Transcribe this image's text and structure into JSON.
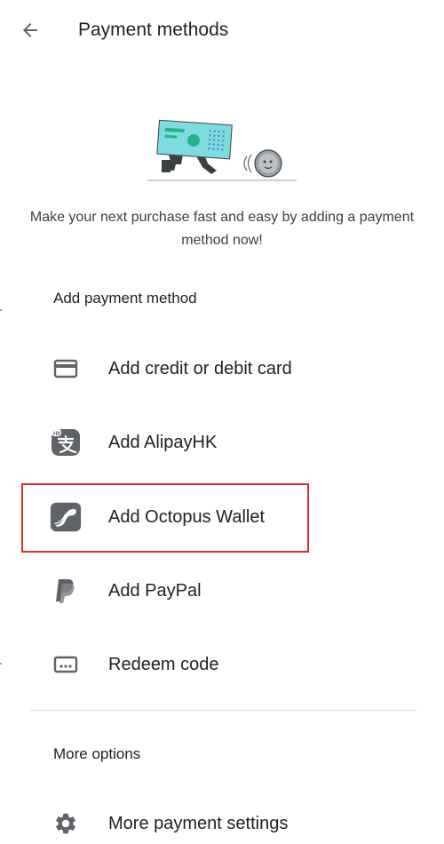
{
  "header": {
    "title": "Payment methods",
    "back_icon": "arrow-back-icon"
  },
  "illustration": {
    "name": "running-cash-illustration",
    "colors": {
      "bill": "#7fdbe0",
      "bill_accent": "#27b38a",
      "coin": "#9aa0a6",
      "legs": "#3c4043"
    }
  },
  "intro_text": "Make your next purchase fast and easy by adding a payment method now!",
  "add_section": {
    "label": "Add payment method",
    "items": [
      {
        "label": "Add credit or debit card",
        "icon": "credit-card-icon"
      },
      {
        "label": "Add AlipayHK",
        "icon": "alipayhk-icon"
      },
      {
        "label": "Add Octopus Wallet",
        "icon": "octopus-icon",
        "highlighted": true
      },
      {
        "label": "Add PayPal",
        "icon": "paypal-icon"
      },
      {
        "label": "Redeem code",
        "icon": "redeem-code-icon"
      }
    ]
  },
  "more_section": {
    "label": "More options",
    "items": [
      {
        "label": "More payment settings",
        "icon": "gear-icon"
      }
    ]
  },
  "colors": {
    "text_primary": "#202124",
    "text_secondary": "#3c4043",
    "icon": "#5f6368",
    "highlight": "#d93025",
    "divider": "#dadce0"
  }
}
